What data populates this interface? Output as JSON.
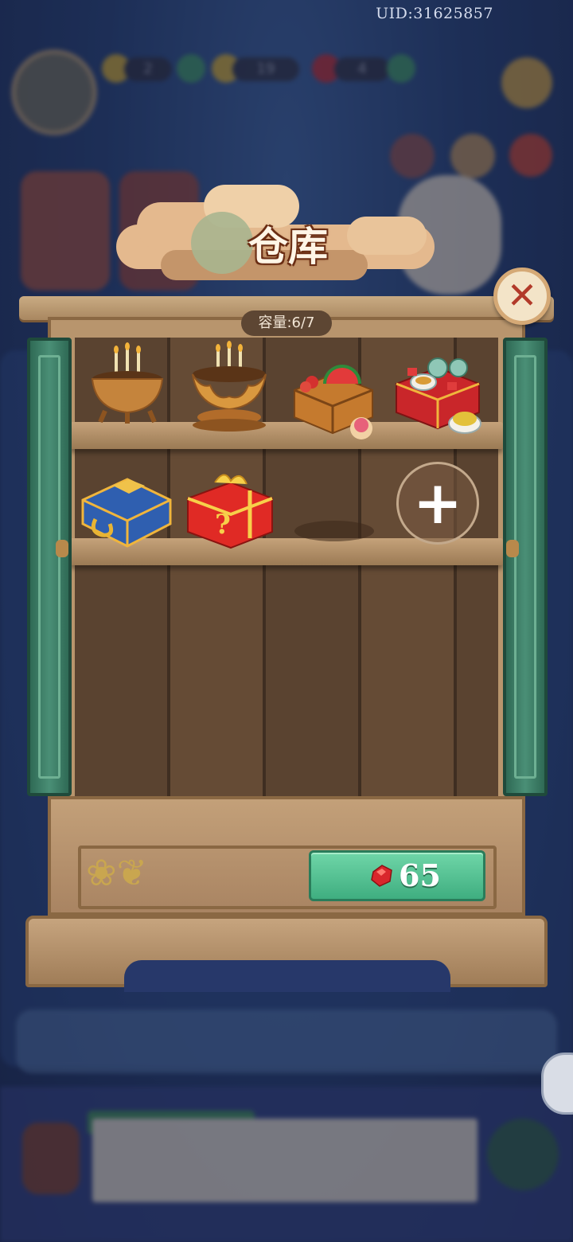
{
  "header": {
    "uid": "UID:31625857",
    "energy": "2",
    "coins": "19",
    "gems": "4"
  },
  "warehouse": {
    "title": "仓库",
    "capacity_label": "容量:6/7",
    "expand_price": "65"
  },
  "items": [
    {
      "icon": "censer-with-candles-icon"
    },
    {
      "icon": "lotus-censer-icon"
    },
    {
      "icon": "fruit-basket-icon"
    },
    {
      "icon": "tea-snack-box-icon"
    },
    {
      "icon": "blue-treasure-chest-icon"
    },
    {
      "icon": "mystery-gift-box-icon"
    }
  ],
  "colors": {
    "door_green": "#3e7f68",
    "price_button": "#4fc191",
    "gem_red": "#d9262c"
  }
}
